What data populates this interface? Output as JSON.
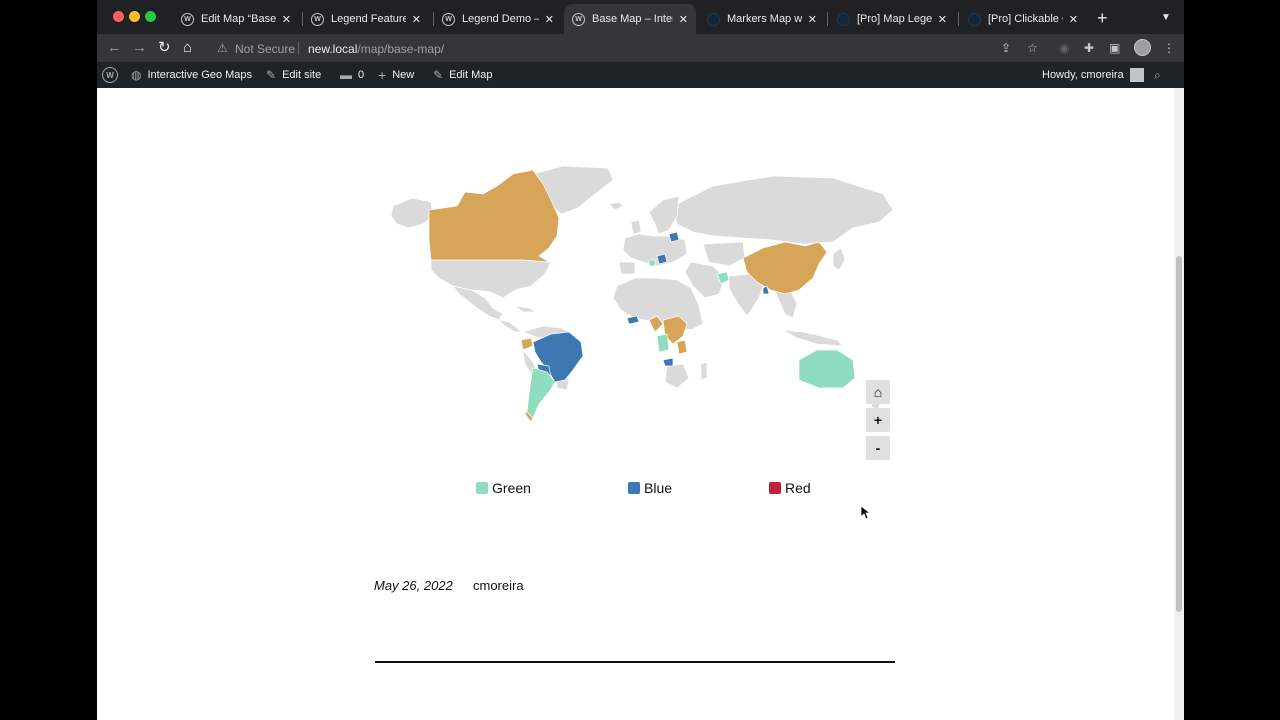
{
  "browser": {
    "tabs": [
      {
        "title": "Edit Map “Base M",
        "favicon": "wordpress",
        "active": false
      },
      {
        "title": "Legend Feature –",
        "favicon": "wordpress",
        "active": false
      },
      {
        "title": "Legend Demo – In",
        "favicon": "wordpress",
        "active": false
      },
      {
        "title": "Base Map – Intera",
        "favicon": "wordpress",
        "active": true
      },
      {
        "title": "Markers Map with",
        "favicon": "dark",
        "active": false
      },
      {
        "title": "[Pro] Map Legend",
        "favicon": "dark",
        "active": false
      },
      {
        "title": "[Pro] Clickable C",
        "favicon": "dark",
        "active": false
      }
    ],
    "security_label": "Not Secure",
    "url_host": "new.local",
    "url_path": "/map/base-map/"
  },
  "admin_bar": {
    "site_name": "Interactive Geo Maps",
    "edit_site": "Edit site",
    "comments_count": "0",
    "new_label": "New",
    "edit_map": "Edit Map",
    "howdy": "Howdy, cmoreira"
  },
  "map": {
    "colors": {
      "green": "#8fdcbf",
      "blue": "#3b78b4",
      "red": "#c4213a",
      "orange": "#d6a558",
      "land": "#dadada"
    },
    "controls": {
      "home": "⌂",
      "zoom_in": "+",
      "zoom_out": "-"
    }
  },
  "legend": [
    {
      "label": "Green",
      "color": "#8fdcbf"
    },
    {
      "label": "Blue",
      "color": "#3b78b4"
    },
    {
      "label": "Red",
      "color": "#c4213a"
    }
  ],
  "post": {
    "date": "May 26, 2022",
    "author": "cmoreira"
  }
}
